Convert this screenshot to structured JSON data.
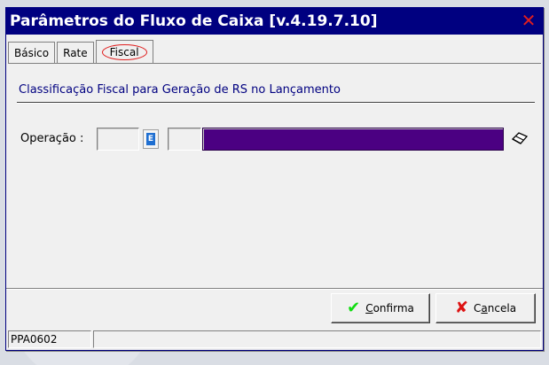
{
  "window": {
    "title": "Parâmetros do Fluxo de Caixa [v.4.19.7.10]",
    "close_glyph": "✕"
  },
  "tabs": [
    {
      "label": "Básico",
      "active": false
    },
    {
      "label": "Rate",
      "active": false
    },
    {
      "label": "Fiscal",
      "active": true
    }
  ],
  "fiscal": {
    "section_title": "Classificação Fiscal para Geração de RS no Lançamento",
    "operacao_label": "Operação :",
    "operacao_code": "",
    "operacao_sub": "",
    "operacao_description": "",
    "lookup_icon": "E"
  },
  "buttons": {
    "confirm_prefix": "",
    "confirm_underline": "C",
    "confirm_rest": "onfirma",
    "cancel_prefix": "C",
    "cancel_underline": "a",
    "cancel_rest": "ncela"
  },
  "status": {
    "program_code": "PPA0602",
    "message": ""
  },
  "colors": {
    "titlebar": "#000080",
    "description_field": "#4b0082",
    "close": "#e01e1e"
  }
}
